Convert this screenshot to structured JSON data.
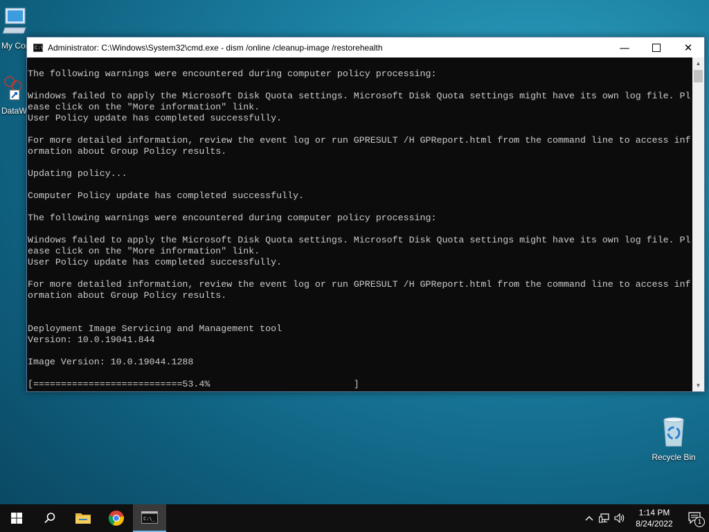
{
  "desktop": {
    "icons": [
      {
        "label": "My Computer"
      },
      {
        "label": "DataWarehouse"
      },
      {
        "label": "Recycle Bin"
      }
    ]
  },
  "window": {
    "title": "Administrator: C:\\Windows\\System32\\cmd.exe - dism  /online /cleanup-image /restorehealth",
    "console_text": "The following warnings were encountered during computer policy processing:\n\nWindows failed to apply the Microsoft Disk Quota settings. Microsoft Disk Quota settings might have its own log file. Pl\nease click on the \"More information\" link.\nUser Policy update has completed successfully.\n\nFor more detailed information, review the event log or run GPRESULT /H GPReport.html from the command line to access inf\normation about Group Policy results.\n\nUpdating policy...\n\nComputer Policy update has completed successfully.\n\nThe following warnings were encountered during computer policy processing:\n\nWindows failed to apply the Microsoft Disk Quota settings. Microsoft Disk Quota settings might have its own log file. Pl\nease click on the \"More information\" link.\nUser Policy update has completed successfully.\n\nFor more detailed information, review the event log or run GPRESULT /H GPReport.html from the command line to access inf\normation about Group Policy results.\n\n\nDeployment Image Servicing and Management tool\nVersion: 10.0.19041.844\n\nImage Version: 10.0.19044.1288\n\n[===========================53.4%                          ]"
  },
  "taskbar": {
    "items": [
      "start",
      "search",
      "file-explorer",
      "chrome",
      "command-prompt"
    ],
    "clock_time": "1:14 PM",
    "clock_date": "8/24/2022",
    "notification_count": "1"
  }
}
